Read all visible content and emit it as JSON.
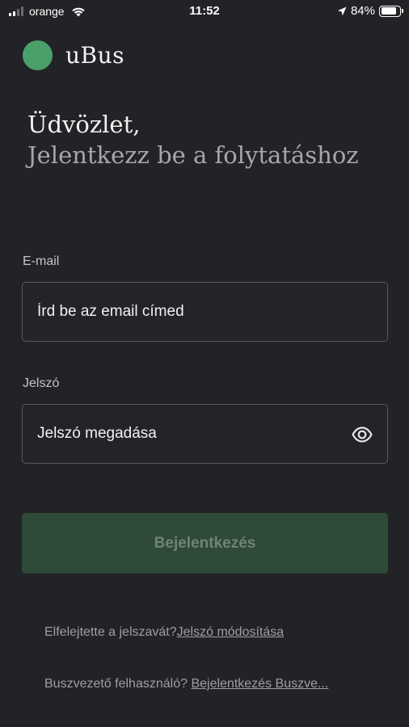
{
  "status_bar": {
    "carrier": "orange",
    "time": "11:52",
    "battery": "84%",
    "battery_level": 0.84
  },
  "app": {
    "name": "uBus",
    "logo_color": "#4aa06b"
  },
  "greeting": {
    "line1": "Üdvözlet,",
    "line2": "Jelentkezz be a folytatáshoz"
  },
  "form": {
    "email_label": "E-mail",
    "email_placeholder": "Írd be az email címed",
    "email_value": "",
    "password_label": "Jelszó",
    "password_placeholder": "Jelszó megadása",
    "password_value": "",
    "password_icon": "eye-icon",
    "submit_label": "Bejelentkezés"
  },
  "links": {
    "forgot_text": "Elfelejtette a jelszavát?",
    "forgot_link": "Jelszó módosítása",
    "driver_text": "Buszvezető felhasználó?",
    "driver_link": "Bejelentkezés Buszve..."
  },
  "colors": {
    "background": "#222326",
    "button": "#2f4a37"
  }
}
